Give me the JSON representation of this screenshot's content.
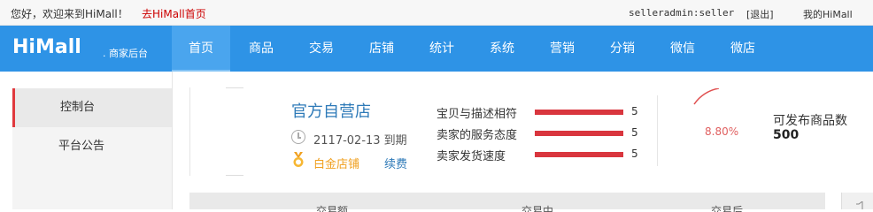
{
  "topbar": {
    "welcome": "您好，欢迎来到HiMall！",
    "home_link": "去HiMall首页",
    "username": "selleradmin:seller",
    "logout": "[退出]",
    "my_mall": "我的HiMall"
  },
  "brand": {
    "logo": "HiMall",
    "subtitle": ". 商家后台"
  },
  "nav": {
    "items": [
      "首页",
      "商品",
      "交易",
      "店铺",
      "统计",
      "系统",
      "营销",
      "分销",
      "微信",
      "微店"
    ],
    "active_index": 0
  },
  "sidebar": {
    "items": [
      "控制台",
      "平台公告"
    ],
    "active_index": 0
  },
  "shop": {
    "name": "官方自营店",
    "expire": "2117-02-13 到期",
    "level": "白金店铺",
    "renew": "续费"
  },
  "ratings": [
    {
      "label": "宝贝与描述相符",
      "value": "5",
      "fill": 1.0
    },
    {
      "label": "卖家的服务态度",
      "value": "5",
      "fill": 1.0
    },
    {
      "label": "卖家发货速度",
      "value": "5",
      "fill": 1.0
    }
  ],
  "quota": {
    "percent": "8.80%",
    "label": "可发布商品数",
    "value": "500"
  },
  "table": {
    "headers": [
      "交易额",
      "交易中",
      "交易后"
    ]
  },
  "colors": {
    "nav_bg": "#2e93e6",
    "accent_red": "#d9363e",
    "link_blue": "#2e7ab8",
    "gold": "#f0a020"
  }
}
